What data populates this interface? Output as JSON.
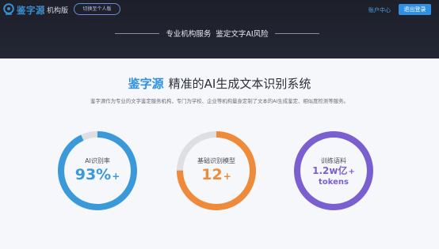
{
  "header": {
    "brand": "鉴字源",
    "edition": "机构版",
    "switch_label": "切换至个人版",
    "account_label": "账户中心",
    "logout_label": "退出登录",
    "slogan": "专业机构服务  鉴定文字AI风险"
  },
  "main": {
    "title_brand": "鉴字源",
    "title_rest": "精准的AI生成文本识别系统",
    "intro": "鉴字源作为专业的文字鉴定服务机构，专门为学校、企业等机构量身定制了文本的AI生成鉴定、相似度检测等服务。"
  },
  "stats": [
    {
      "label": "AI识别率",
      "value": "93%",
      "plus": "+",
      "color": "#3a9ad9",
      "fill": 0.93
    },
    {
      "label": "基础识别模型",
      "value": "12",
      "plus": "+",
      "color": "#ef8a3a",
      "fill": 0.75
    },
    {
      "label": "训练语料",
      "value": "1.2w亿",
      "plus": "+",
      "sub": "tokens",
      "color": "#7a5fd0",
      "fill": 1.0
    }
  ],
  "colors": {
    "brand_blue": "#2f8fe0",
    "header_bg": "#1d1f2a",
    "track_gray": "#dedfe3"
  }
}
